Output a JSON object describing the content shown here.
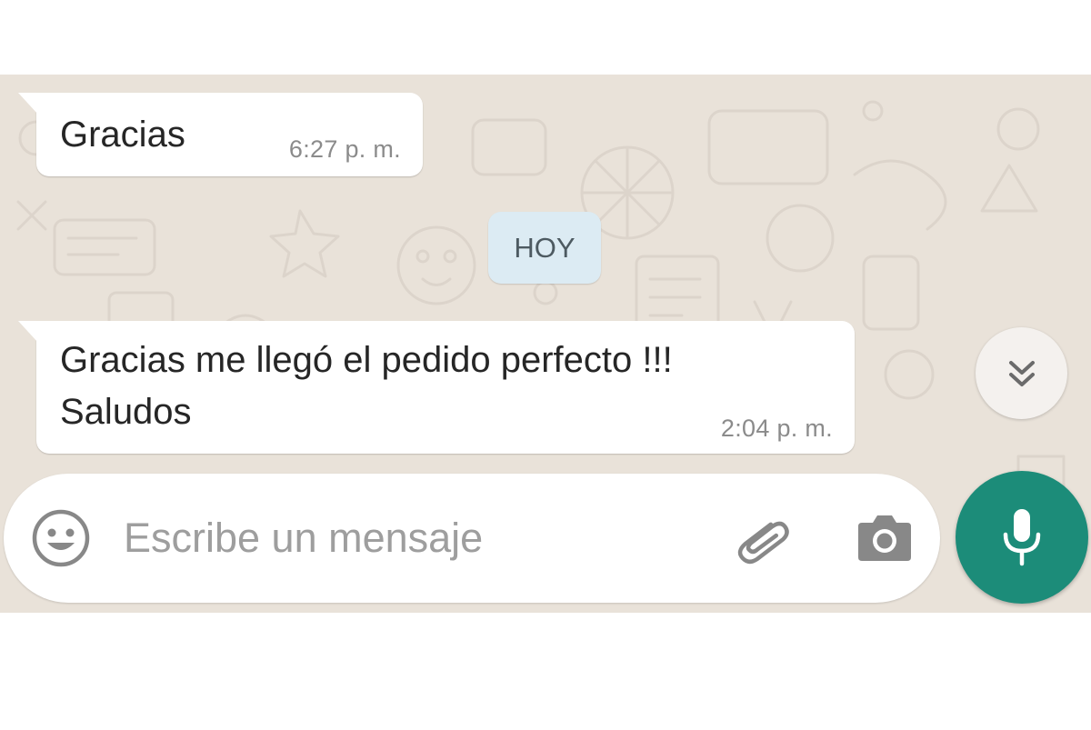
{
  "colors": {
    "wallpaper": "#e9e2d9",
    "bubble_incoming": "#ffffff",
    "date_chip": "#dcebf3",
    "accent_green": "#1c8c79",
    "meta_text": "#8b8b8b"
  },
  "messages": [
    {
      "direction": "incoming",
      "text": "Gracias",
      "time": "6:27 p. m."
    },
    {
      "direction": "incoming",
      "text": "Gracias me llegó el pedido perfecto !!!\nSaludos",
      "time": "2:04 p. m."
    }
  ],
  "date_separator": "HOY",
  "composer": {
    "placeholder": "Escribe un mensaje",
    "value": ""
  },
  "icons": {
    "emoji": "emoji-icon",
    "attach": "paperclip-icon",
    "camera": "camera-icon",
    "mic": "mic-icon",
    "scroll": "double-chevron-down-icon"
  }
}
